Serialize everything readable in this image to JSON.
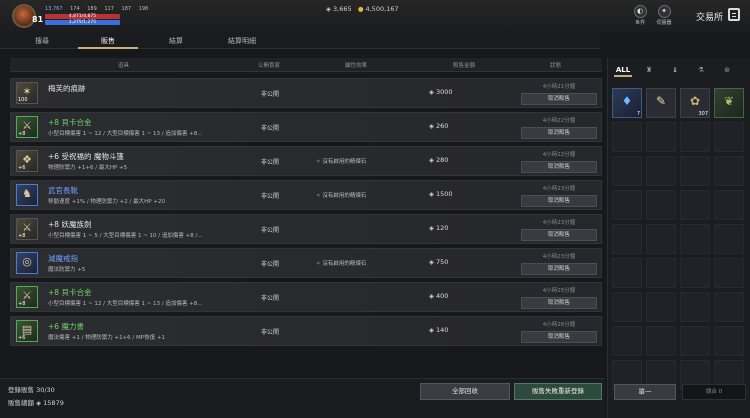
{
  "player": {
    "level": "81",
    "stats": [
      "13,767",
      "174",
      "189",
      "117",
      "187",
      "198"
    ],
    "hp": "4,871/4,875",
    "mp": "1,275/1,275"
  },
  "currency": {
    "diamond": "3,665",
    "gold": "4,500,167"
  },
  "top_icons": [
    {
      "label": "世界",
      "icon": "world-icon"
    },
    {
      "label": "伺服器",
      "icon": "server-icon"
    }
  ],
  "exchange_title": "交易所",
  "tabs": [
    "搜尋",
    "販售",
    "結算",
    "結算明細"
  ],
  "list_headers": {
    "item": "道具",
    "public": "公開喜家",
    "refine": "屬性效果",
    "price": "販售金額",
    "status": "狀態"
  },
  "listings": [
    {
      "name": "梅芙的痕跡",
      "grade": "plain",
      "badge": "100",
      "glyph": "✶",
      "desc": "",
      "public": "非公開",
      "refine": "",
      "price": "3000",
      "time": "4小時21分鐘",
      "action": "取消販售"
    },
    {
      "name": "+8 貝卡合金",
      "grade": "green",
      "badge": "+8",
      "glyph": "⚔",
      "desc": "小型目標傷害 1 ~ 12 / 大型目標傷害 1 ~ 13 / 追加傷害 +8...",
      "desc_hl": "",
      "public": "非公開",
      "refine": "",
      "price": "260",
      "time": "4小時22分鐘",
      "action": "取消販售"
    },
    {
      "name": "+6 受祝福的 魔物斗篷",
      "grade": "plain",
      "badge": "+6",
      "glyph": "❖",
      "desc": "物理防禦力 +1+6 / 最大HP +5",
      "desc_hl": "+6",
      "public": "非公開",
      "refine": "沒有啟用的精煉石",
      "price": "280",
      "time": "4小時22分鐘",
      "action": "取消販售"
    },
    {
      "name": "武官長靴",
      "grade": "blue",
      "badge": "",
      "glyph": "♞",
      "desc": "移動速度 +1% / 物理防禦力 +2 / 最大HP +20",
      "desc_hl": "",
      "public": "非公開",
      "refine": "沒有啟用的精煉石",
      "price": "1500",
      "time": "4小時23分鐘",
      "action": "取消販售"
    },
    {
      "name": "+8 妖魔族劍",
      "grade": "plain",
      "badge": "+8",
      "glyph": "⚔",
      "desc": "小型目標傷害 1 ~ 5 / 大型目標傷害 1 ~ 10 / 追加傷害 +8 /...",
      "desc_hl": "",
      "public": "非公開",
      "refine": "",
      "price": "120",
      "time": "4小時23分鐘",
      "action": "取消販售"
    },
    {
      "name": "減魔戒指",
      "grade": "blue",
      "badge": "",
      "glyph": "◎",
      "desc": "魔法防禦力 +5",
      "desc_hl": "",
      "public": "非公開",
      "refine": "沒有啟用的精煉石",
      "price": "750",
      "time": "4小時23分鐘",
      "action": "取消販售"
    },
    {
      "name": "+8 貝卡合金",
      "grade": "green",
      "badge": "+8",
      "glyph": "⚔",
      "desc": "小型目標傷害 1 ~ 12 / 大型目標傷害 1 ~ 13 / 追加傷害 +8...",
      "desc_hl": "",
      "public": "非公開",
      "refine": "",
      "price": "400",
      "time": "4小時25分鐘",
      "action": "取消販售"
    },
    {
      "name": "+6 魔力書",
      "grade": "green",
      "badge": "+6",
      "glyph": "▤",
      "desc": "魔法傷害 +1 / 物理防禦力 +1+6 / MP恢復 +1",
      "desc_hl": "+6",
      "public": "非公開",
      "refine": "",
      "price": "140",
      "time": "4小時26分鐘",
      "action": "取消販售"
    }
  ],
  "footer": {
    "registered_label": "登錄販售",
    "registered_value": "30/30",
    "total_label": "販售總額",
    "total_value": "15879",
    "recall_all": "全部回收",
    "reregister": "販售失敗重新登錄"
  },
  "right_panel": {
    "category_all": "ALL",
    "single_button": "單一",
    "total_label": "總合",
    "total_value": "0"
  },
  "inventory": [
    {
      "glyph": "♦",
      "color": "#6fb7ff",
      "count": "7",
      "tier": "b",
      "fade": false
    },
    {
      "glyph": "✎",
      "color": "#e8d6b0",
      "count": "",
      "tier": "",
      "fade": false
    },
    {
      "glyph": "✿",
      "color": "#c8b46a",
      "count": "307",
      "tier": "",
      "fade": false
    },
    {
      "glyph": "❦",
      "color": "#9fc46a",
      "count": "",
      "tier": "g",
      "fade": false
    }
  ]
}
